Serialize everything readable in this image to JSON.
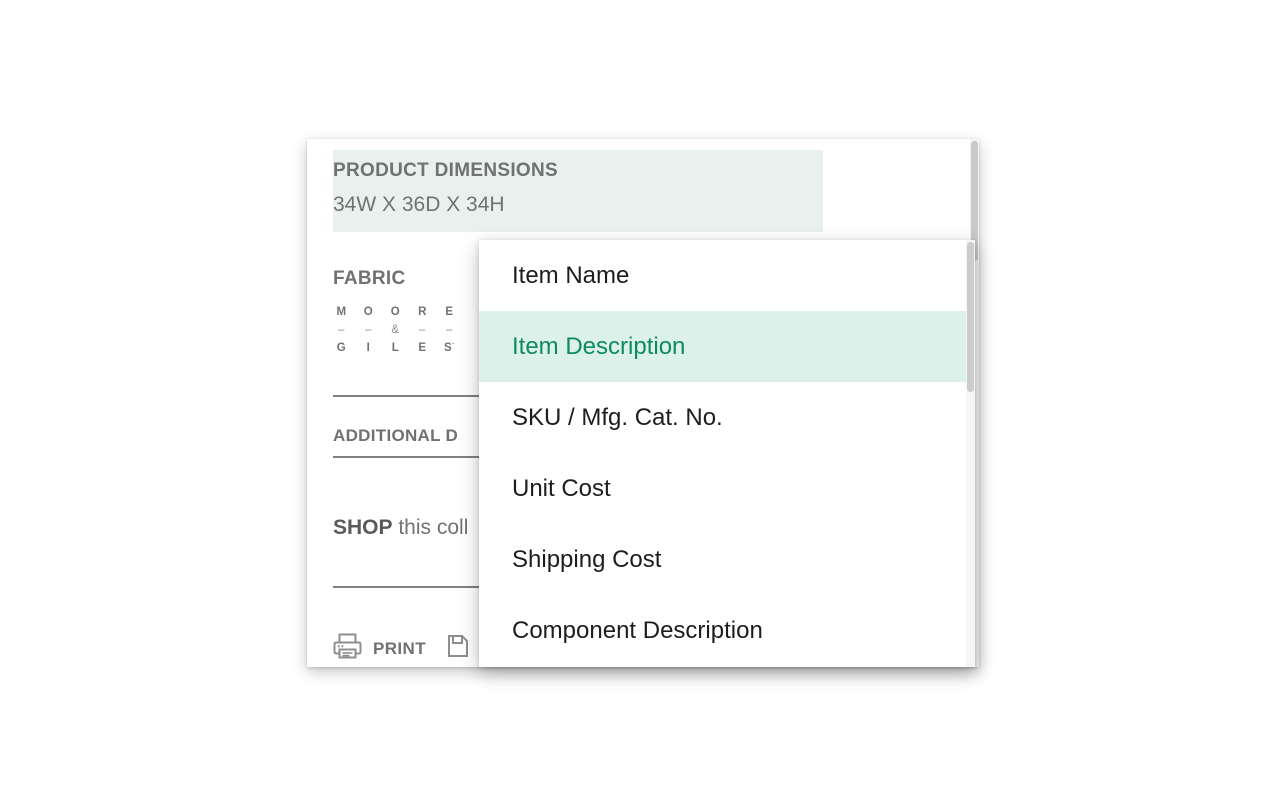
{
  "panel": {
    "dimensions": {
      "label": "PRODUCT DIMENSIONS",
      "value": "34W X 36D X 34H"
    },
    "fabric": {
      "label": "FABRIC",
      "brand_rows": [
        [
          "M",
          "O",
          "O",
          "R",
          "E"
        ],
        [
          "–",
          "–",
          "&",
          "–",
          "–"
        ],
        [
          "G",
          "I",
          "L",
          "E",
          "S"
        ]
      ],
      "brand_tm": "·"
    },
    "additional": {
      "label": "ADDITIONAL D"
    },
    "shop": {
      "bold": "SHOP",
      "rest": " this coll"
    },
    "actions": [
      {
        "icon": "printer-icon",
        "label": "PRINT"
      },
      {
        "icon": "save-icon",
        "label": ""
      }
    ]
  },
  "dropdown": {
    "items": [
      {
        "label": "Item Name",
        "selected": false
      },
      {
        "label": "Item Description",
        "selected": true
      },
      {
        "label": "SKU / Mfg. Cat. No.",
        "selected": false
      },
      {
        "label": "Unit Cost",
        "selected": false
      },
      {
        "label": "Shipping Cost",
        "selected": false
      },
      {
        "label": "Component Description",
        "selected": false
      }
    ]
  },
  "colors": {
    "highlight_block": "#e8f1ee",
    "selected_row_bg": "#dcf1ea",
    "selected_row_text": "#0e8a61",
    "body_text": "#6f7271",
    "menu_text": "#1d1d1d"
  }
}
